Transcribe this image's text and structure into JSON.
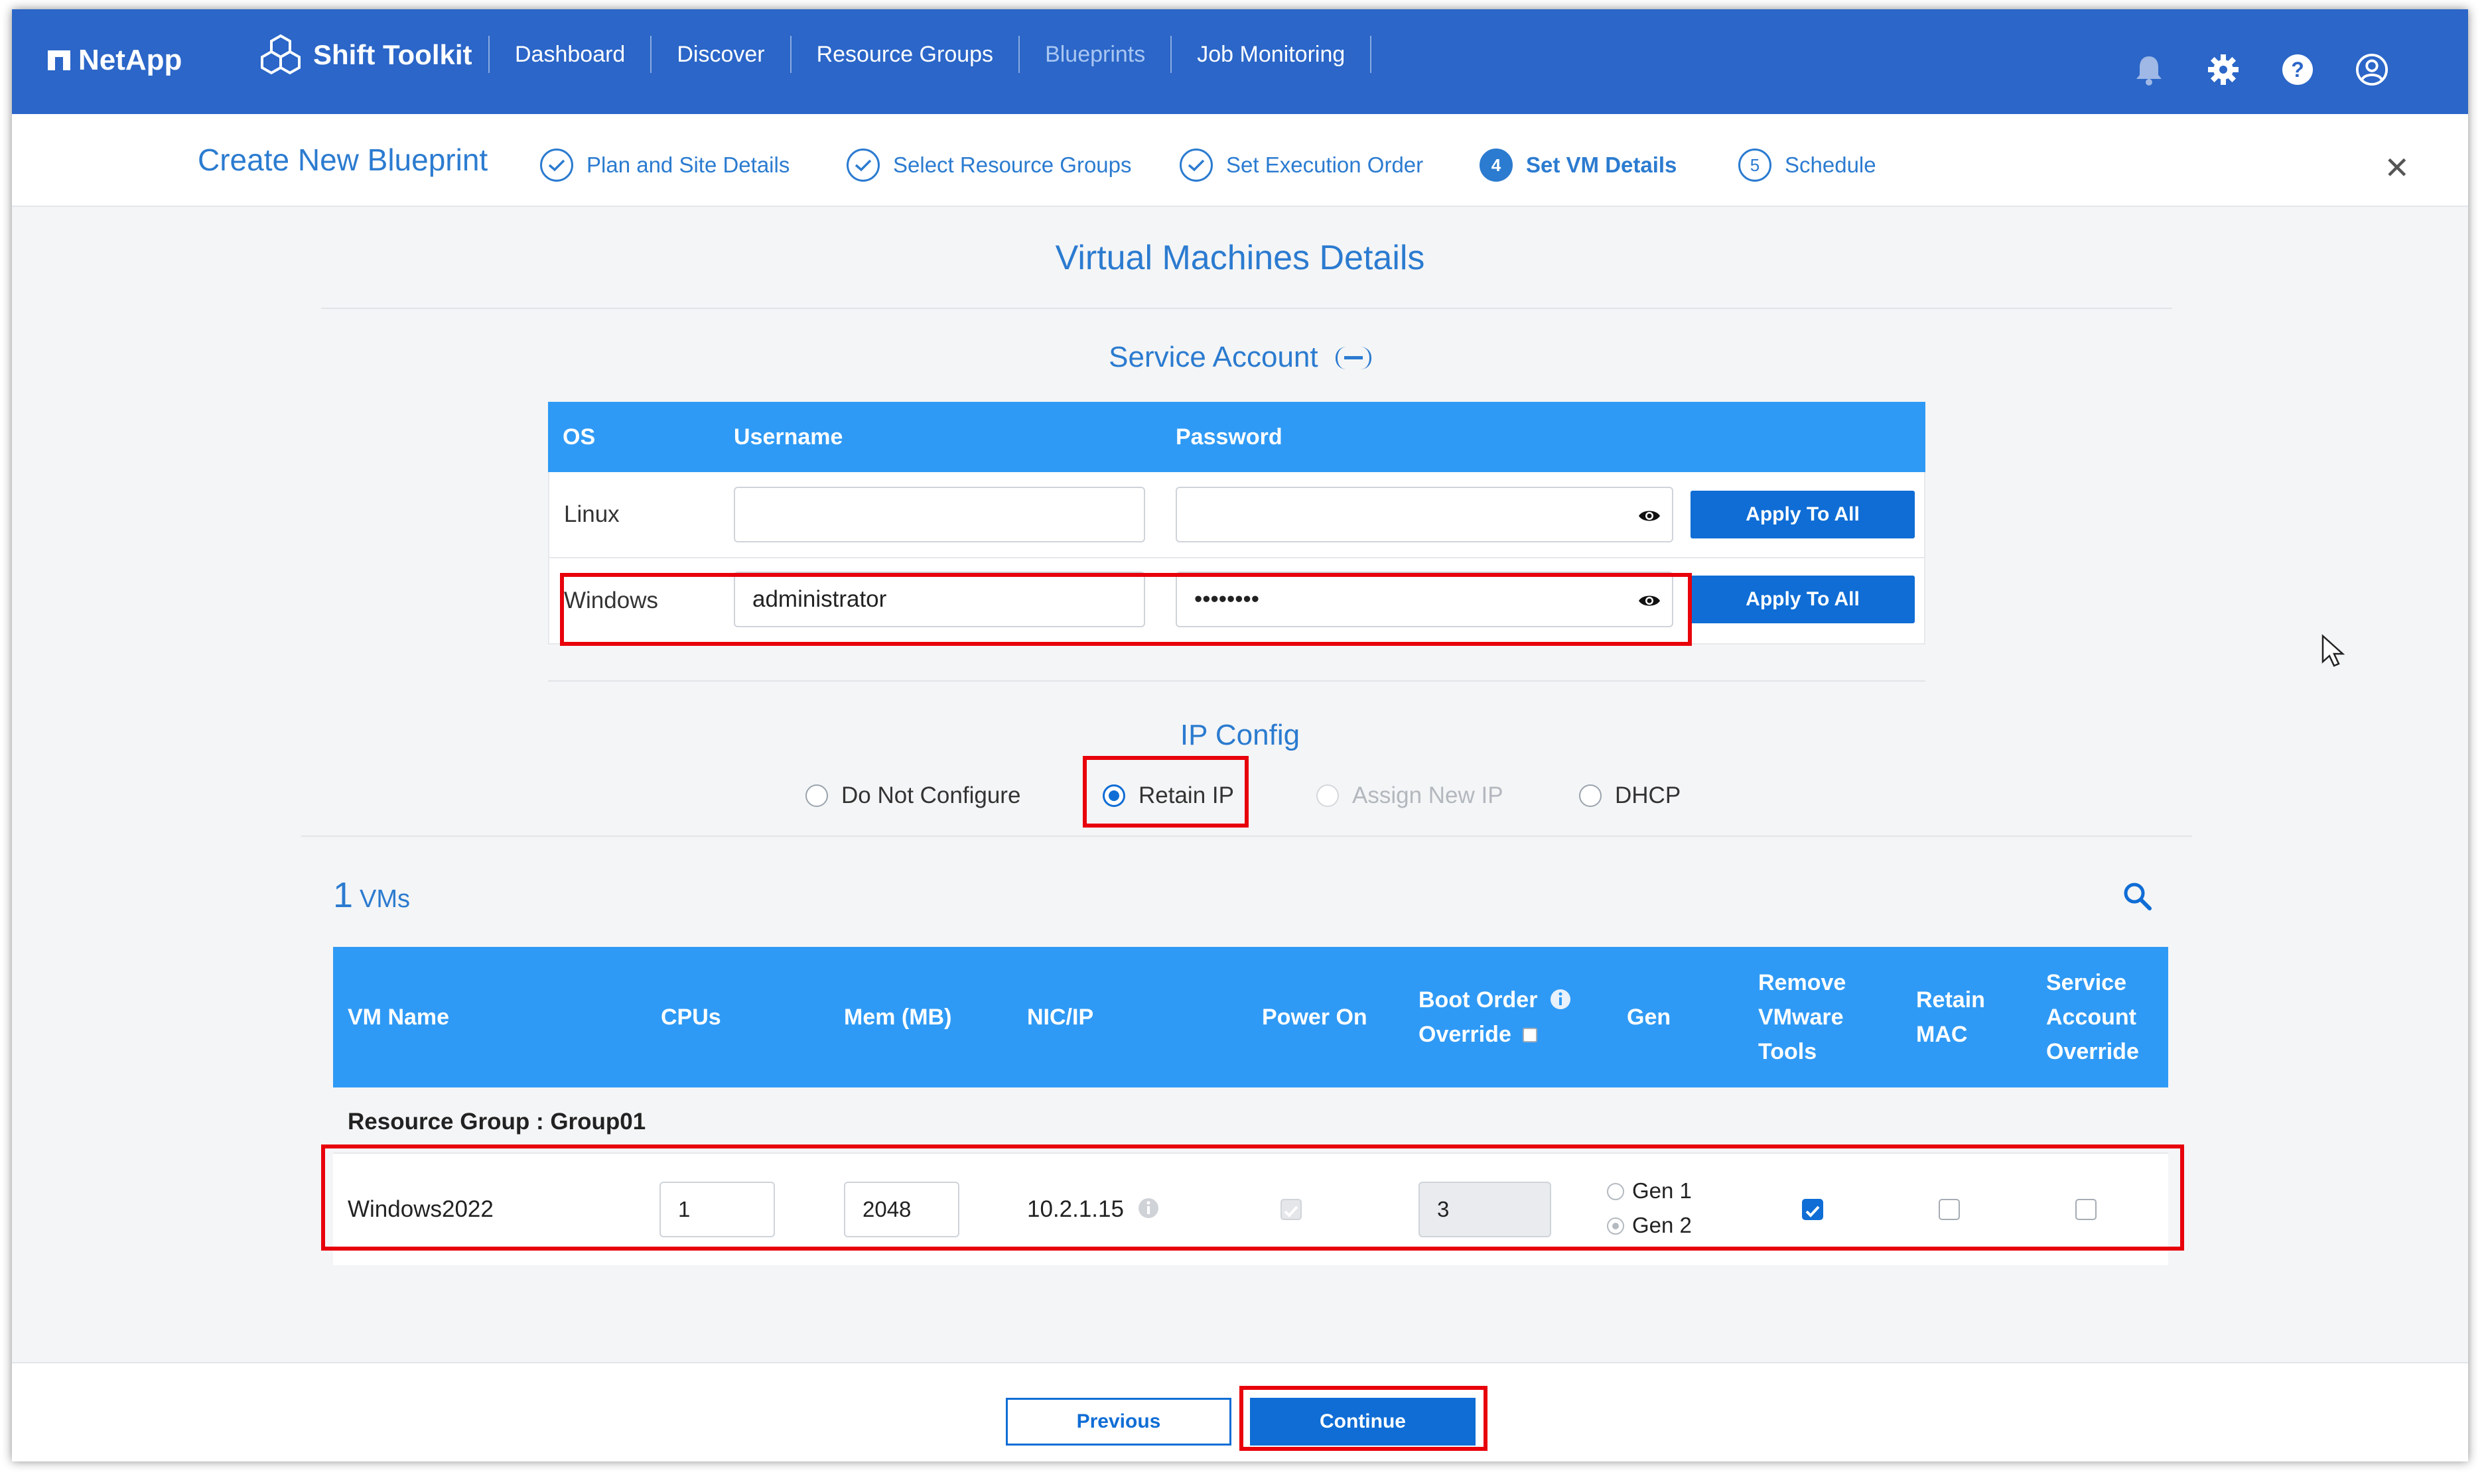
{
  "nav": {
    "brand": "NetApp",
    "product": "Shift Toolkit",
    "items": [
      "Dashboard",
      "Discover",
      "Resource Groups",
      "Blueprints",
      "Job Monitoring"
    ],
    "active_item": "Blueprints",
    "icons": [
      "bell-icon",
      "gear-icon",
      "help-icon",
      "user-icon"
    ]
  },
  "stepper": {
    "title": "Create New Blueprint",
    "steps": [
      {
        "num": "1",
        "label": "Plan and Site Details",
        "state": "done"
      },
      {
        "num": "2",
        "label": "Select Resource Groups",
        "state": "done"
      },
      {
        "num": "3",
        "label": "Set Execution Order",
        "state": "done"
      },
      {
        "num": "4",
        "label": "Set VM Details",
        "state": "active"
      },
      {
        "num": "5",
        "label": "Schedule",
        "state": "pending"
      }
    ]
  },
  "page": {
    "title": "Virtual Machines Details"
  },
  "service_account": {
    "title": "Service Account",
    "headers": {
      "os": "OS",
      "username": "Username",
      "password": "Password"
    },
    "rows": [
      {
        "os": "Linux",
        "username": "",
        "password": "",
        "apply": "Apply To All"
      },
      {
        "os": "Windows",
        "username": "administrator",
        "password": "••••••••",
        "apply": "Apply To All"
      }
    ]
  },
  "ip_config": {
    "title": "IP Config",
    "options": [
      "Do Not Configure",
      "Retain IP",
      "Assign New IP",
      "DHCP"
    ],
    "selected": "Retain IP"
  },
  "vms": {
    "count": "1",
    "count_label": "VMs",
    "headers": {
      "name": "VM Name",
      "cpus": "CPUs",
      "mem": "Mem (MB)",
      "nic": "NIC/IP",
      "power": "Power On",
      "boot_1": "Boot Order",
      "boot_2": "Override",
      "gen": "Gen",
      "remove_1": "Remove",
      "remove_2": "VMware",
      "remove_3": "Tools",
      "retain_1": "Retain",
      "retain_2": "MAC",
      "svc_1": "Service",
      "svc_2": "Account",
      "svc_3": "Override"
    },
    "group_label": "Resource Group : Group01",
    "rows": [
      {
        "name": "Windows2022",
        "cpus": "1",
        "mem": "2048",
        "nic": "10.2.1.15",
        "boot_order": "3",
        "gen_options": [
          "Gen 1",
          "Gen 2"
        ],
        "gen_selected": "Gen 2"
      }
    ]
  },
  "footer": {
    "previous": "Previous",
    "continue": "Continue"
  },
  "colors": {
    "nav_bg": "#2b66c8",
    "table_header": "#2f9af5",
    "primary": "#0f6dd5",
    "highlight": "#e8000b"
  }
}
